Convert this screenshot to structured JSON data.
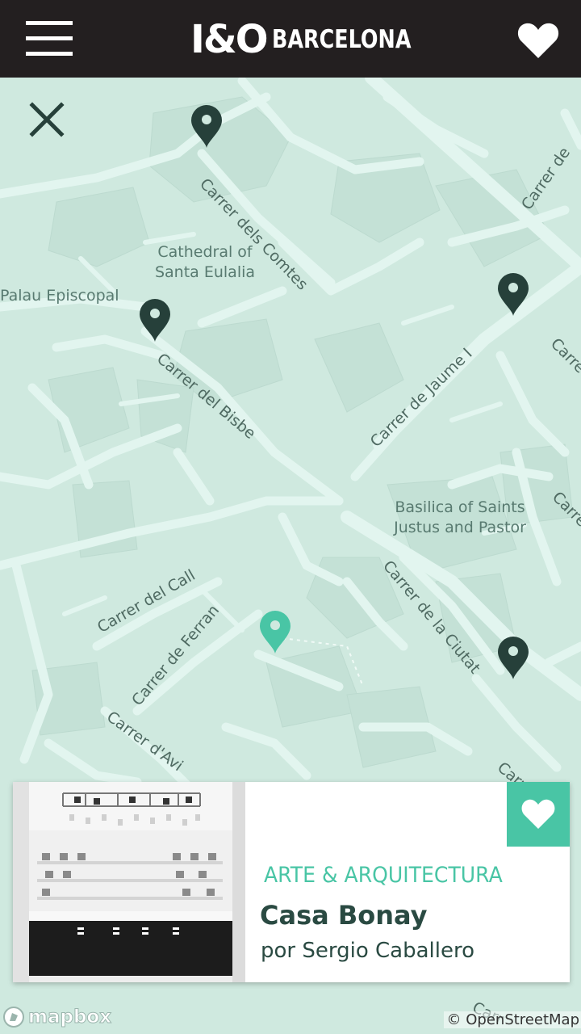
{
  "header": {
    "logo_mark": "I&O",
    "logo_city": "BARCELONA",
    "menu_icon": "hamburger-menu-icon",
    "favorites_icon": "heart-icon"
  },
  "colors": {
    "header_bg": "#231f20",
    "map_land": "#cfe9df",
    "map_roads": "#e2f5ef",
    "pin_dark": "#26403a",
    "pin_active": "#49c5a5",
    "accent": "#49c5a5",
    "title": "#2a4a42"
  },
  "map": {
    "close_icon": "close-icon",
    "streets": [
      "Carrer dels Comtes",
      "Carrer del Bisbe",
      "Carrer de Jaume I",
      "Carrer del Call",
      "Carrer de Ferran",
      "Carrer de la Ciutat",
      "Carrer d'Avi",
      "Carrer de",
      "Carre",
      "Carre",
      "Carr",
      "Carr"
    ],
    "pois": [
      "Cathedral of Santa Eulalia",
      "Palau Episcopal",
      "Basilica of Saints Justus and Pastor"
    ],
    "poi_lines": {
      "cathedral": [
        "Cathedral of",
        "Santa Eulalia"
      ],
      "basilica": [
        "Basilica of Saints",
        "Justus and Pastor"
      ]
    },
    "pins": [
      {
        "type": "location",
        "active": false
      },
      {
        "type": "location",
        "active": false
      },
      {
        "type": "location",
        "active": false
      },
      {
        "type": "location",
        "active": true
      },
      {
        "type": "location",
        "active": false
      }
    ]
  },
  "card": {
    "category": "ARTE & ARQUITECTURA",
    "title": "Casa Bonay",
    "author": "por Sergio Caballero",
    "favorite_icon": "heart-icon"
  },
  "footer": {
    "mapbox": "mapbox",
    "attribution": "© OpenStreetMap"
  }
}
